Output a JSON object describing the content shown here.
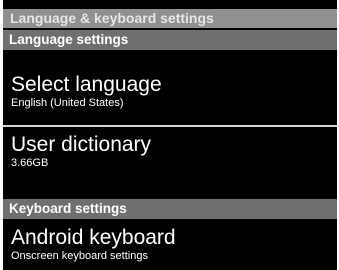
{
  "screen": {
    "title": "Language & keyboard settings"
  },
  "language_settings": {
    "header": "Language settings",
    "items": [
      {
        "title": "Select language",
        "summary": "English (United States)"
      },
      {
        "title": "User dictionary",
        "summary": "3.66GB"
      }
    ]
  },
  "keyboard_settings": {
    "header": "Keyboard settings",
    "items": [
      {
        "title": "Android keyboard",
        "summary": "Onscreen keyboard settings"
      }
    ]
  }
}
